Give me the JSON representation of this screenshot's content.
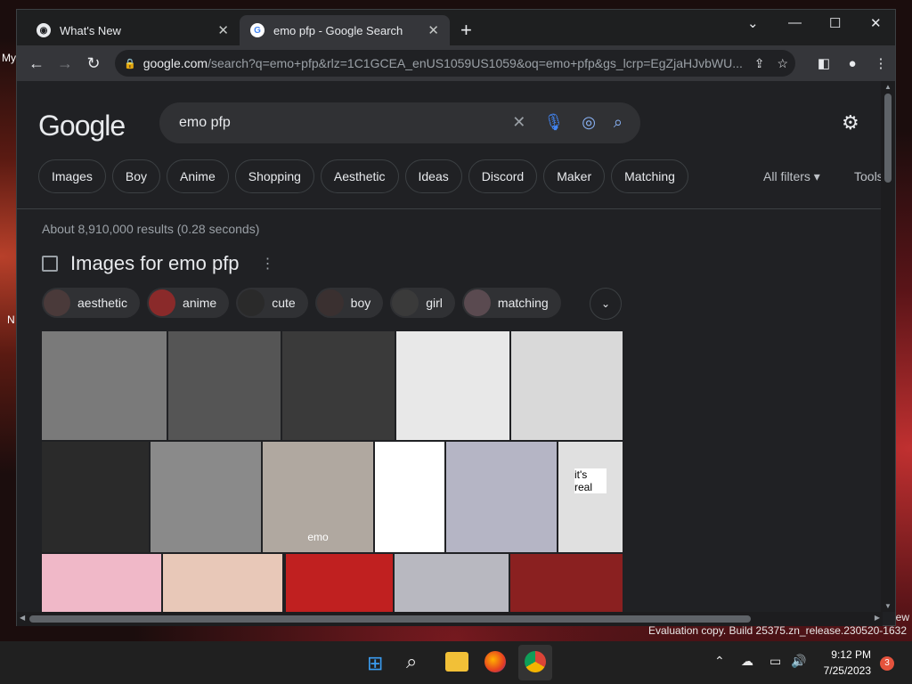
{
  "desktop": {
    "left_labels": [
      "My",
      "N"
    ],
    "eval_text": "Evaluation copy. Build 25375.zn_release.230520-1632",
    "ew_text": "ew"
  },
  "tabs": [
    {
      "title": "What's New",
      "favicon": "chrome-icon",
      "active": false
    },
    {
      "title": "emo pfp - Google Search",
      "favicon": "google-icon",
      "active": true
    }
  ],
  "address": {
    "domain": "google.com",
    "path": "/search?q=emo+pfp&rlz=1C1GCEA_enUS1059US1059&oq=emo+pfp&gs_lcrp=EgZjaHJvbWU..."
  },
  "search": {
    "logo": "Google",
    "query": "emo pfp"
  },
  "filter_chips": [
    "Images",
    "Boy",
    "Anime",
    "Shopping",
    "Aesthetic",
    "Ideas",
    "Discord",
    "Maker",
    "Matching"
  ],
  "all_filters": "All filters",
  "tools": "Tools",
  "results_count": "About 8,910,000 results (0.28 seconds)",
  "images_header": "Images for emo pfp",
  "related_pills": [
    {
      "label": "aesthetic",
      "color": "#4a3a3a"
    },
    {
      "label": "anime",
      "color": "#8a2a2a"
    },
    {
      "label": "cute",
      "color": "#2a2a2a"
    },
    {
      "label": "boy",
      "color": "#3a3030"
    },
    {
      "label": "girl",
      "color": "#3a3a3a"
    },
    {
      "label": "matching",
      "color": "#5a4a50"
    }
  ],
  "image_tiles": [
    {
      "bg": "#7a7a7a",
      "caption": ""
    },
    {
      "bg": "#555555",
      "caption": ""
    },
    {
      "bg": "#3a3a3a",
      "caption": ""
    },
    {
      "bg": "#e8e8e8",
      "caption": ""
    },
    {
      "bg": "#d9d9d9",
      "caption": ""
    },
    {
      "bg": "#2a2a2a",
      "caption": ""
    },
    {
      "bg": "#8a8a8a",
      "caption": ""
    },
    {
      "bg": "#b0a8a0",
      "caption": "emo"
    },
    {
      "bg": "#ffffff",
      "caption": ""
    },
    {
      "bg": "#b5b5c5",
      "caption": ""
    },
    {
      "bg": "#e0e0e0",
      "caption": "it's real"
    },
    {
      "bg": "#f0b8c8",
      "caption": ""
    },
    {
      "bg": "#e8c8b8",
      "caption": ""
    },
    {
      "bg": "#c02020",
      "caption": ""
    },
    {
      "bg": "#b8b8c0",
      "caption": ""
    },
    {
      "bg": "#8a2020",
      "caption": ""
    }
  ],
  "taskbar": {
    "time": "9:12 PM",
    "date": "7/25/2023",
    "notification_count": "3"
  }
}
